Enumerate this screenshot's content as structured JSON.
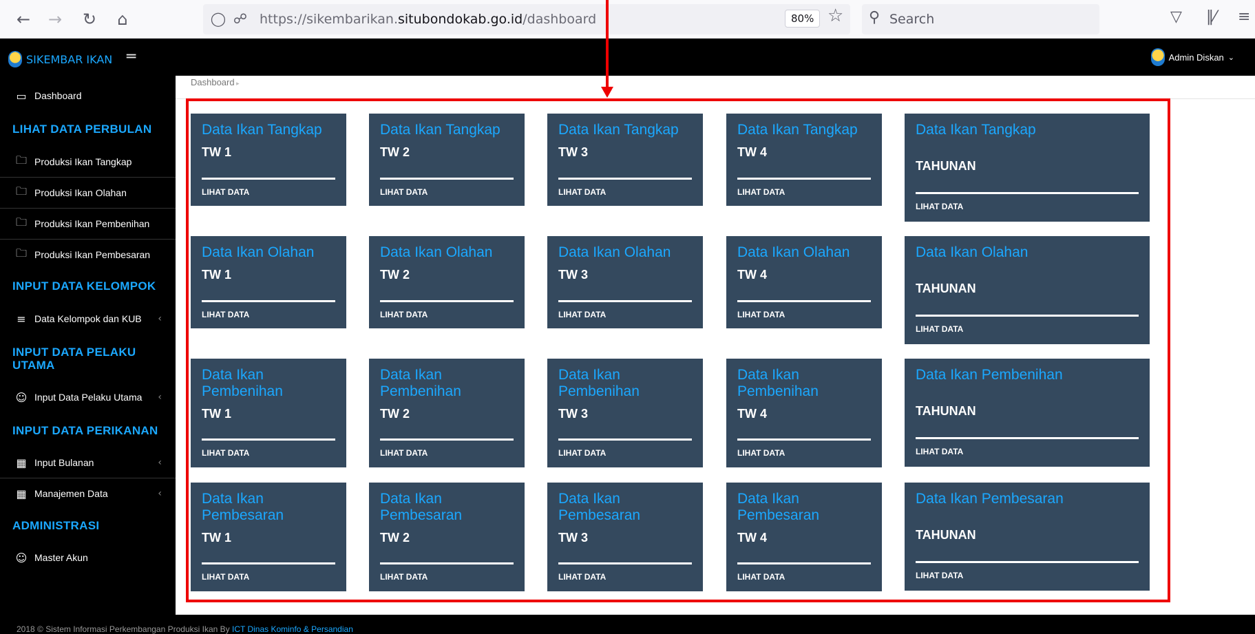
{
  "browser": {
    "url_prefix": "https://sikembarikan.",
    "url_domain": "situbondokab.go.id",
    "url_path": "/dashboard",
    "zoom": "80%",
    "search_placeholder": "Search"
  },
  "header": {
    "brand": "SIKEMBAR IKAN",
    "user": "Admin Diskan"
  },
  "sidebar": {
    "dashboard": "Dashboard",
    "sections": [
      {
        "title": "LIHAT DATA PERBULAN"
      },
      {
        "title": "INPUT DATA KELOMPOK"
      },
      {
        "title": "INPUT DATA PELAKU UTAMA"
      },
      {
        "title": "INPUT DATA PERIKANAN"
      },
      {
        "title": "ADMINISTRASI"
      }
    ],
    "items": [
      {
        "label": "Produksi Ikan Tangkap",
        "icon": "folder-icon"
      },
      {
        "label": "Produksi Ikan Olahan",
        "icon": "folder-icon"
      },
      {
        "label": "Produksi Ikan Pembenihan",
        "icon": "folder-icon"
      },
      {
        "label": "Produksi Ikan Pembesaran",
        "icon": "folder-icon"
      },
      {
        "label": "Data Kelompok dan KUB",
        "icon": "list-icon"
      },
      {
        "label": "Input Data Pelaku Utama",
        "icon": "users-icon"
      },
      {
        "label": "Input Bulanan",
        "icon": "calendar-icon"
      },
      {
        "label": "Manajemen Data",
        "icon": "calendar-icon"
      },
      {
        "label": "Master Akun",
        "icon": "user-icon"
      }
    ]
  },
  "breadcrumb": "Dashboard",
  "tiles": [
    [
      {
        "title": "Data Ikan Tangkap",
        "sub": "TW 1",
        "link": "LIHAT DATA"
      },
      {
        "title": "Data Ikan Tangkap",
        "sub": "TW 2",
        "link": "LIHAT DATA"
      },
      {
        "title": "Data Ikan Tangkap",
        "sub": "TW 3",
        "link": "LIHAT DATA"
      },
      {
        "title": "Data Ikan Tangkap",
        "sub": "TW 4",
        "link": "LIHAT DATA"
      },
      {
        "title": "Data Ikan Tangkap",
        "sub": "TAHUNAN",
        "link": "LIHAT DATA"
      }
    ],
    [
      {
        "title": "Data Ikan Olahan",
        "sub": "TW 1",
        "link": "LIHAT DATA"
      },
      {
        "title": "Data Ikan Olahan",
        "sub": "TW 2",
        "link": "LIHAT DATA"
      },
      {
        "title": "Data Ikan Olahan",
        "sub": "TW 3",
        "link": "LIHAT DATA"
      },
      {
        "title": "Data Ikan Olahan",
        "sub": "TW 4",
        "link": "LIHAT DATA"
      },
      {
        "title": "Data Ikan Olahan",
        "sub": "TAHUNAN",
        "link": "LIHAT DATA"
      }
    ],
    [
      {
        "title": "Data Ikan Pembenihan",
        "sub": "TW 1",
        "link": "LIHAT DATA"
      },
      {
        "title": "Data Ikan Pembenihan",
        "sub": "TW 2",
        "link": "LIHAT DATA"
      },
      {
        "title": "Data Ikan Pembenihan",
        "sub": "TW 3",
        "link": "LIHAT DATA"
      },
      {
        "title": "Data Ikan Pembenihan",
        "sub": "TW 4",
        "link": "LIHAT DATA"
      },
      {
        "title": "Data Ikan Pembenihan",
        "sub": "TAHUNAN",
        "link": "LIHAT DATA"
      }
    ],
    [
      {
        "title": "Data Ikan Pembesaran",
        "sub": "TW 1",
        "link": "LIHAT DATA"
      },
      {
        "title": "Data Ikan Pembesaran",
        "sub": "TW 2",
        "link": "LIHAT DATA"
      },
      {
        "title": "Data Ikan Pembesaran",
        "sub": "TW 3",
        "link": "LIHAT DATA"
      },
      {
        "title": "Data Ikan Pembesaran",
        "sub": "TW 4",
        "link": "LIHAT DATA"
      },
      {
        "title": "Data Ikan Pembesaran",
        "sub": "TAHUNAN",
        "link": "LIHAT DATA"
      }
    ]
  ],
  "footer": {
    "text": "2018 © Sistem Informasi Perkembangan Produksi Ikan By ",
    "link": "ICT Dinas Kominfo & Persandian"
  },
  "colors": {
    "accent": "#1ba8ff",
    "tile_bg": "#34495e",
    "highlight": "#e00000"
  }
}
